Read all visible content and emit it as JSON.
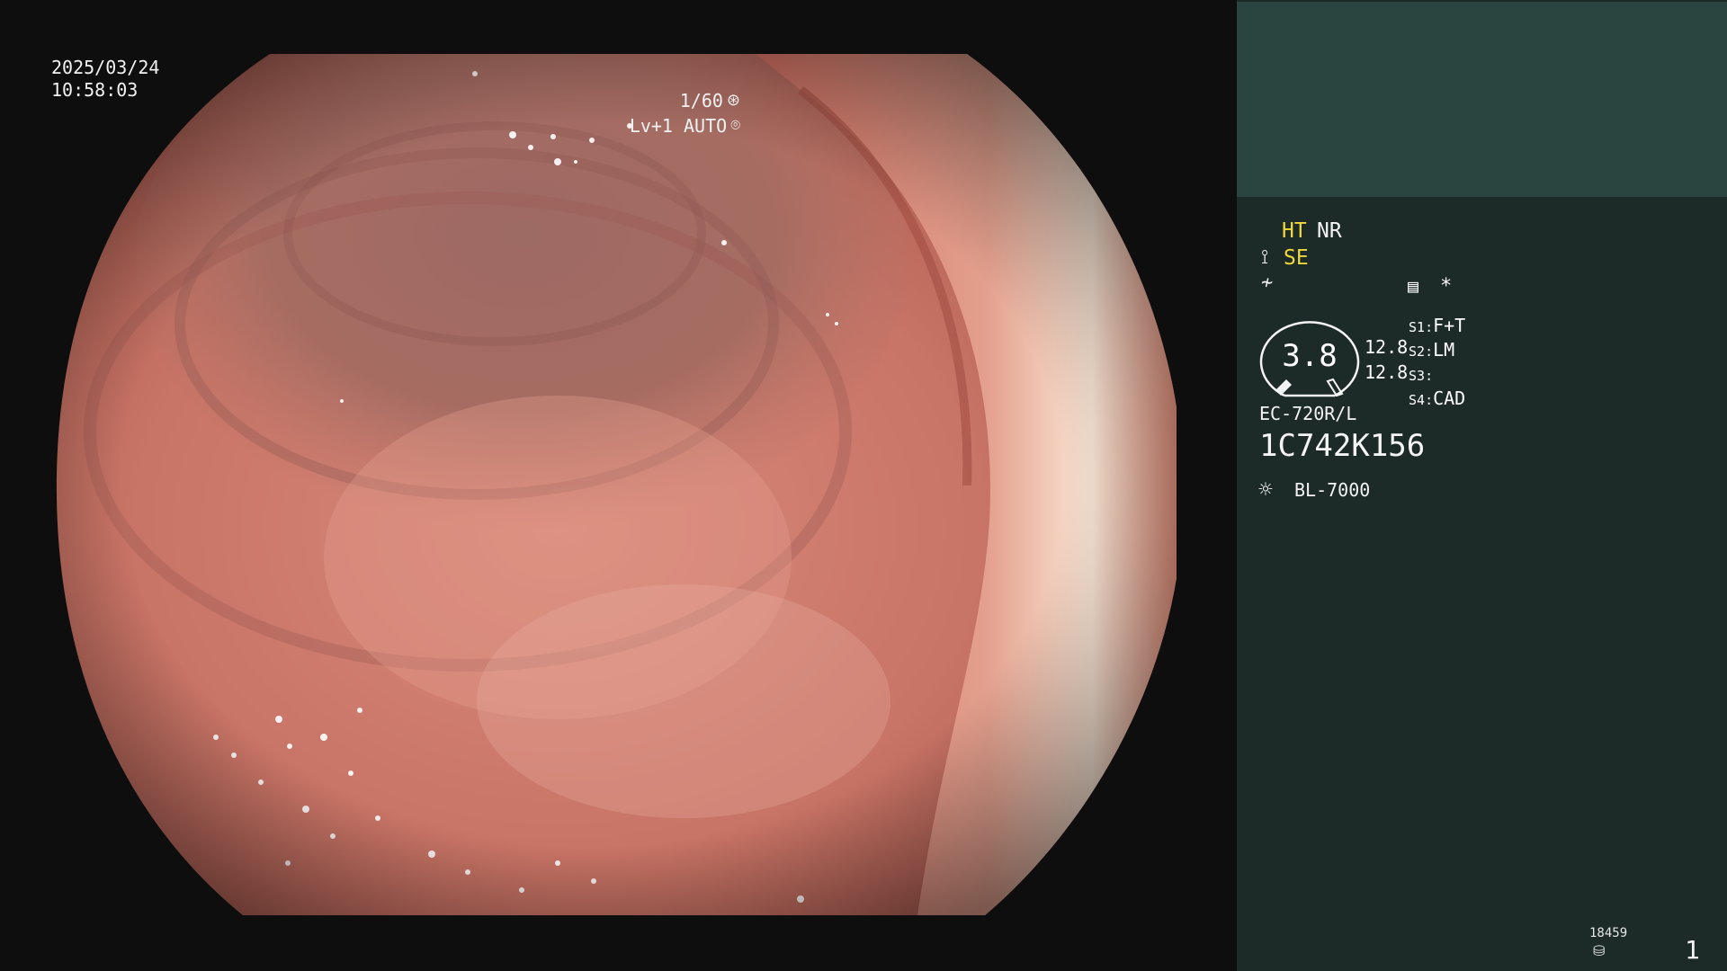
{
  "video": {
    "date": "2025/03/24",
    "time": "10:58:03",
    "shutter": "1/60",
    "shutter_icon": "aperture-icon",
    "level": "Lv+1 AUTO",
    "auto_icon": "iris-icon",
    "image_content": "endoscopic view of colon lumen"
  },
  "panel": {
    "ht": "HT",
    "nr": "NR",
    "se_icon": "magnify-hand-icon",
    "se": "SE",
    "structure_icon": "structure-enhance-icon",
    "memo_icon": "memo-icon",
    "star": "*",
    "gauge_value": "3.8",
    "scale_top": "12.8",
    "scale_bottom": "12.8",
    "switches": [
      {
        "label": "S1",
        "value": "F+T"
      },
      {
        "label": "S2",
        "value": "LM"
      },
      {
        "label": "S3",
        "value": ""
      },
      {
        "label": "S4",
        "value": "CAD"
      }
    ],
    "model": "EC-720R/L",
    "serial": "1C742K156",
    "light_icon": "sun-icon",
    "light_source": "BL-7000",
    "counter": "18459",
    "disk_icon": "disk-icon",
    "page": "1"
  },
  "colors": {
    "panel_bg": "#1c2a28",
    "panel_top_bg": "#2a4440",
    "highlight_yellow": "#f3d83a",
    "tissue_base": "#c8776a"
  }
}
